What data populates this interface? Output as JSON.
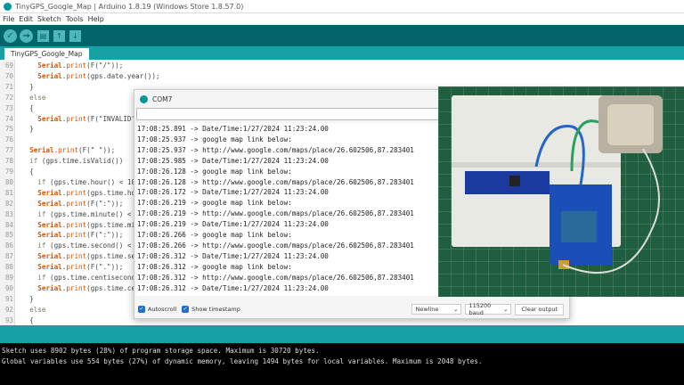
{
  "window_title": "TinyGPS_Google_Map | Arduino 1.8.19 (Windows Store 1.8.57.0)",
  "menu": [
    "File",
    "Edit",
    "Sketch",
    "Tools",
    "Help"
  ],
  "toolbar": {
    "verify": "✓",
    "upload": "→",
    "new": "▤",
    "open": "↑",
    "save": "↓"
  },
  "tab": "TinyGPS_Google_Map",
  "code": [
    {
      "n": "69",
      "t": "    Serial.print(F(\"/\"));"
    },
    {
      "n": "70",
      "t": "    Serial.print(gps.date.year());"
    },
    {
      "n": "71",
      "t": "  }"
    },
    {
      "n": "72",
      "t": "  else"
    },
    {
      "n": "73",
      "t": "  {"
    },
    {
      "n": "74",
      "t": "    Serial.print(F(\"INVALID\""
    },
    {
      "n": "75",
      "t": "  }"
    },
    {
      "n": "76",
      "t": ""
    },
    {
      "n": "77",
      "t": "  Serial.print(F(\" \"));"
    },
    {
      "n": "78",
      "t": "  if (gps.time.isValid())"
    },
    {
      "n": "79",
      "t": "  {"
    },
    {
      "n": "80",
      "t": "    if (gps.time.hour() < 10"
    },
    {
      "n": "81",
      "t": "    Serial.print(gps.time.ho"
    },
    {
      "n": "82",
      "t": "    Serial.print(F(\":\"));"
    },
    {
      "n": "83",
      "t": "    if (gps.time.minute() <"
    },
    {
      "n": "84",
      "t": "    Serial.print(gps.time.mi"
    },
    {
      "n": "85",
      "t": "    Serial.print(F(\":\"));"
    },
    {
      "n": "86",
      "t": "    if (gps.time.second() <"
    },
    {
      "n": "87",
      "t": "    Serial.print(gps.time.se"
    },
    {
      "n": "88",
      "t": "    Serial.print(F(\".\"));"
    },
    {
      "n": "89",
      "t": "    if (gps.time.centisecond"
    },
    {
      "n": "90",
      "t": "    Serial.print(gps.time.ce"
    },
    {
      "n": "91",
      "t": "  }"
    },
    {
      "n": "92",
      "t": "  else"
    },
    {
      "n": "93",
      "t": "  {"
    }
  ],
  "serial_monitor": {
    "title": "COM7",
    "input_value": "",
    "output": [
      "17:08:25.891 -> Date/Time:1/27/2024 11:23:24.00",
      "17:08:25.937 -> google map link below:",
      "17:08:25.937 -> http://www.google.com/maps/place/26.602506,87.283401",
      "17:08:25.985 -> Date/Time:1/27/2024 11:23:24.00",
      "17:08:26.128 -> google map link below:",
      "17:08:26.128 -> http://www.google.com/maps/place/26.602506,87.283401",
      "17:08:26.172 -> Date/Time:1/27/2024 11:23:24.00",
      "17:08:26.219 -> google map link below:",
      "17:08:26.219 -> http://www.google.com/maps/place/26.602506,87.283401",
      "17:08:26.219 -> Date/Time:1/27/2024 11:23:24.00",
      "17:08:26.266 -> google map link below:",
      "17:08:26.266 -> http://www.google.com/maps/place/26.602506,87.283401",
      "17:08:26.312 -> Date/Time:1/27/2024 11:23:24.00",
      "17:08:26.312 -> google map link below:",
      "17:08:26.312 -> http://www.google.com/maps/place/26.602506,87.283401",
      "17:08:26.312 -> Date/Time:1/27/2024 11:23:24.00"
    ],
    "autoscroll": "Autoscroll",
    "show_timestamp": "Show timestamp",
    "line_ending": "Newline",
    "baud": "115200 baud",
    "clear": "Clear output"
  },
  "console": [
    "Sketch uses 8902 bytes (28%) of program storage space. Maximum is 30720 bytes.",
    "Global variables use 554 bytes (27%) of dynamic memory, leaving 1494 bytes for local variables. Maximum is 2048 bytes."
  ]
}
